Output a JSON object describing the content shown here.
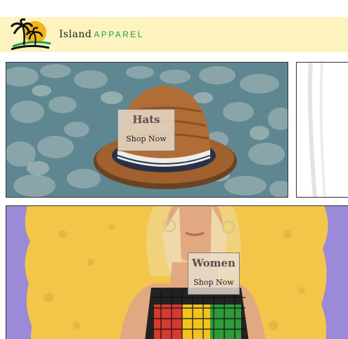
{
  "header": {
    "brand_primary": "Island",
    "brand_secondary": "APPAREL",
    "colors": {
      "background": "#fdf3bf",
      "brand_green": "#1f9e4a"
    }
  },
  "tiles": [
    {
      "title": "Hats",
      "cta": "Shop Now"
    },
    {
      "title": "Women",
      "cta": "Shop Now"
    }
  ]
}
